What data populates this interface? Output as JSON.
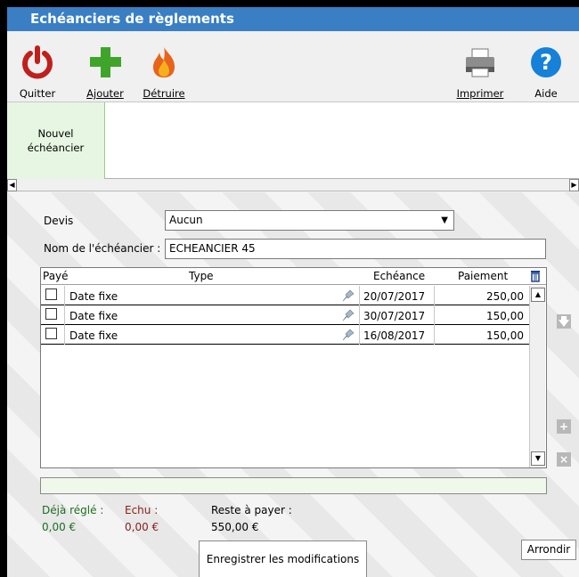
{
  "window": {
    "title": "Echéanciers de règlements"
  },
  "toolbar": {
    "quit_label": "Quitter",
    "add_label": "Ajouter",
    "destroy_label": "Détruire",
    "print_label": "Imprimer",
    "help_label": "Aide"
  },
  "tabs": {
    "new_schedule_line1": "Nouvel",
    "new_schedule_line2": "échéancier"
  },
  "form": {
    "devis_label": "Devis",
    "devis_value": "Aucun",
    "name_label": "Nom de l'échéancier :",
    "name_value": "ECHEANCIER 45"
  },
  "grid": {
    "headers": {
      "paid": "Payé",
      "type": "Type",
      "due": "Echéance",
      "payment": "Paiement"
    },
    "rows": [
      {
        "paid": false,
        "type": "Date fixe",
        "due": "20/07/2017",
        "payment": "250,00"
      },
      {
        "paid": false,
        "type": "Date fixe",
        "due": "30/07/2017",
        "payment": "150,00"
      },
      {
        "paid": false,
        "type": "Date fixe",
        "due": "16/08/2017",
        "payment": "150,00"
      }
    ]
  },
  "summary": {
    "paid_label": "Déjà réglé :",
    "paid_value": "0,00 €",
    "due_label": "Echu :",
    "due_value": "0,00 €",
    "remaining_label": "Reste à payer :",
    "remaining_value": "550,00 €"
  },
  "buttons": {
    "save_label": "Enregistrer les modifications",
    "round_label": "Arrondir"
  },
  "colors": {
    "titlebar": "#3a7fc4",
    "paid_text": "#1b6d1f",
    "due_text": "#8a1b1b",
    "tab_bg": "#e6f6e2"
  }
}
